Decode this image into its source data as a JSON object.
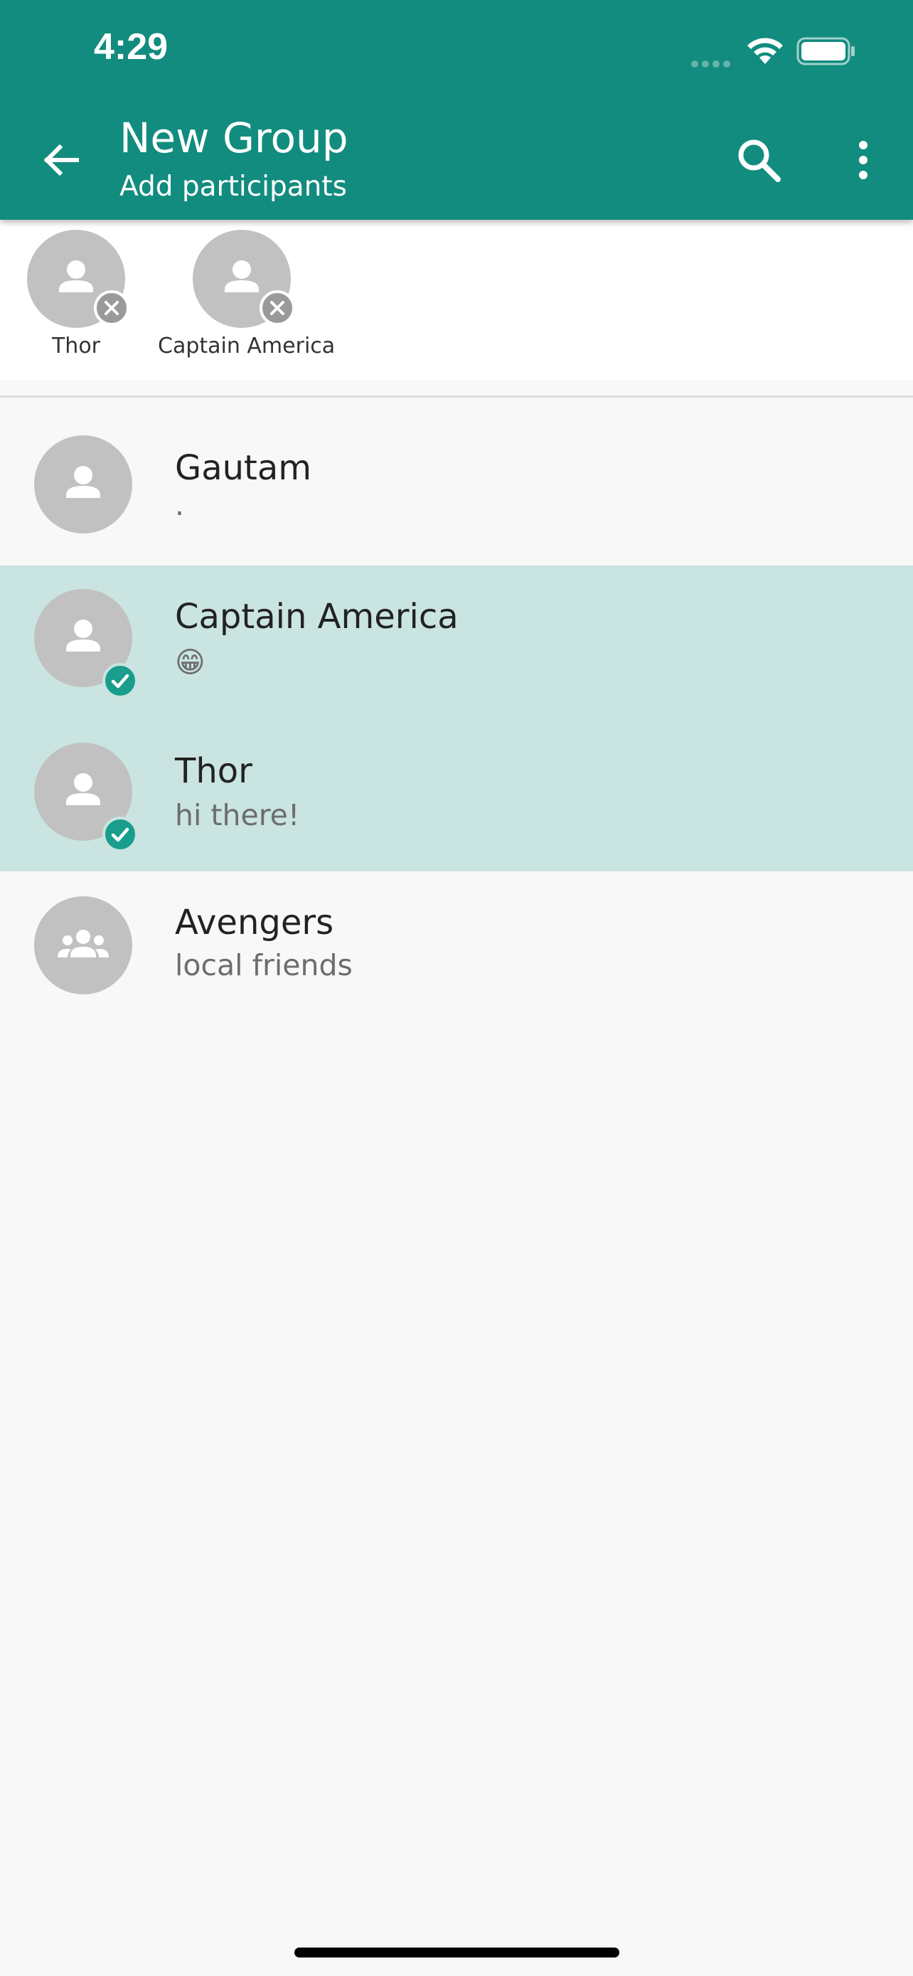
{
  "status_bar": {
    "time": "4:29"
  },
  "appbar": {
    "title": "New Group",
    "subtitle": "Add participants"
  },
  "selected_participants": [
    {
      "name": "Thor"
    },
    {
      "name": "Captain America"
    }
  ],
  "contacts": [
    {
      "name": "Gautam",
      "status": ".",
      "selected": false,
      "type": "person"
    },
    {
      "name": "Captain America",
      "status": "😁",
      "selected": true,
      "type": "person"
    },
    {
      "name": "Thor",
      "status": "hi there!",
      "selected": true,
      "type": "person"
    },
    {
      "name": "Avengers",
      "status": "local friends",
      "selected": false,
      "type": "group"
    }
  ],
  "colors": {
    "primary": "#128c7e",
    "selected_row": "#cae4e1",
    "check": "#199d8c",
    "avatar": "#c1c1c1"
  }
}
